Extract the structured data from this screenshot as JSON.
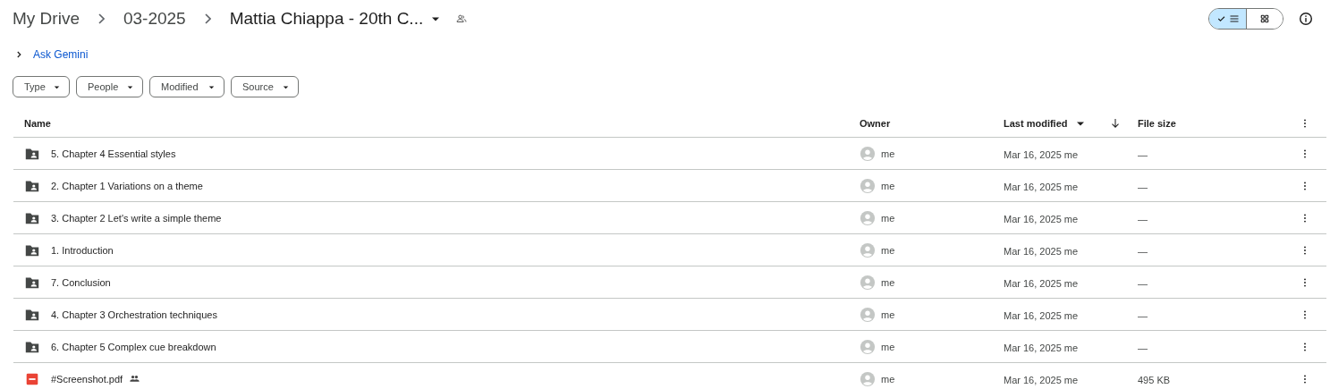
{
  "breadcrumbs": [
    {
      "label": "My Drive",
      "current": false
    },
    {
      "label": "03-2025",
      "current": false
    },
    {
      "label": "Mattia Chiappa - 20th C...",
      "current": true
    }
  ],
  "view_toggle": [
    {
      "kind": "list",
      "selected": true
    },
    {
      "kind": "grid",
      "selected": false
    }
  ],
  "gemini": {
    "label": "Ask Gemini",
    "expanded": false
  },
  "filters": [
    {
      "label": "Type"
    },
    {
      "label": "People"
    },
    {
      "label": "Modified"
    },
    {
      "label": "Source"
    }
  ],
  "table": {
    "columns": [
      {
        "label": "Name"
      },
      {
        "label": "Owner"
      },
      {
        "label": "Last modified",
        "sorted": true
      },
      {
        "label": "File size"
      }
    ],
    "rows": [
      {
        "kind": "folder",
        "name": "5. Chapter 4 Essential styles",
        "shared": false,
        "owner": "me",
        "modified": "Mar 16, 2025 me",
        "size": "—"
      },
      {
        "kind": "folder",
        "name": "2. Chapter 1 Variations on a theme",
        "shared": false,
        "owner": "me",
        "modified": "Mar 16, 2025 me",
        "size": "—"
      },
      {
        "kind": "folder",
        "name": "3. Chapter 2 Let's write a simple theme",
        "shared": false,
        "owner": "me",
        "modified": "Mar 16, 2025 me",
        "size": "—"
      },
      {
        "kind": "folder",
        "name": "1. Introduction",
        "shared": false,
        "owner": "me",
        "modified": "Mar 16, 2025 me",
        "size": "—"
      },
      {
        "kind": "folder",
        "name": "7. Conclusion",
        "shared": false,
        "owner": "me",
        "modified": "Mar 16, 2025 me",
        "size": "—"
      },
      {
        "kind": "folder",
        "name": "4. Chapter 3 Orchestration techniques",
        "shared": false,
        "owner": "me",
        "modified": "Mar 16, 2025 me",
        "size": "—"
      },
      {
        "kind": "folder",
        "name": "6. Chapter 5 Complex cue breakdown",
        "shared": false,
        "owner": "me",
        "modified": "Mar 16, 2025 me",
        "size": "—"
      },
      {
        "kind": "pdf",
        "name": "#Screenshot.pdf",
        "shared": true,
        "owner": "me",
        "modified": "Mar 16, 2025 me",
        "size": "495 KB"
      }
    ]
  }
}
